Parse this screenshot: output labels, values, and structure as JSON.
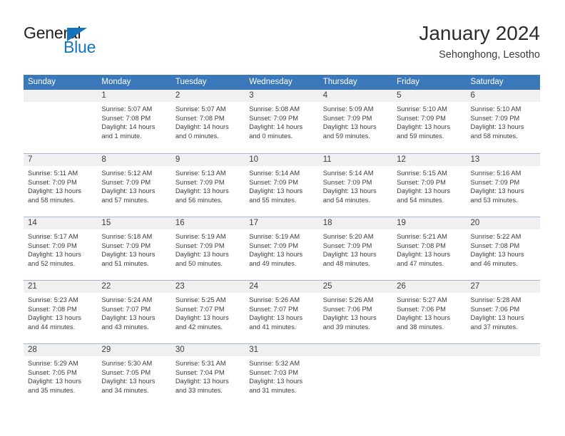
{
  "brand": {
    "name_part1": "General",
    "name_part2": "Blue",
    "accent_color": "#1474bb",
    "triangle_icon": "brand-triangle-icon"
  },
  "header": {
    "title": "January 2024",
    "subtitle": "Sehonghong, Lesotho"
  },
  "calendar": {
    "header_color": "#3a78ba",
    "daynum_band_color": "#f0f0f0",
    "weekdays": [
      "Sunday",
      "Monday",
      "Tuesday",
      "Wednesday",
      "Thursday",
      "Friday",
      "Saturday"
    ],
    "weeks": [
      [
        {
          "day": "",
          "blank": true,
          "sunrise": "",
          "sunset": "",
          "daylight1": "",
          "daylight2": ""
        },
        {
          "day": "1",
          "sunrise": "Sunrise: 5:07 AM",
          "sunset": "Sunset: 7:08 PM",
          "daylight1": "Daylight: 14 hours",
          "daylight2": "and 1 minute."
        },
        {
          "day": "2",
          "sunrise": "Sunrise: 5:07 AM",
          "sunset": "Sunset: 7:08 PM",
          "daylight1": "Daylight: 14 hours",
          "daylight2": "and 0 minutes."
        },
        {
          "day": "3",
          "sunrise": "Sunrise: 5:08 AM",
          "sunset": "Sunset: 7:09 PM",
          "daylight1": "Daylight: 14 hours",
          "daylight2": "and 0 minutes."
        },
        {
          "day": "4",
          "sunrise": "Sunrise: 5:09 AM",
          "sunset": "Sunset: 7:09 PM",
          "daylight1": "Daylight: 13 hours",
          "daylight2": "and 59 minutes."
        },
        {
          "day": "5",
          "sunrise": "Sunrise: 5:10 AM",
          "sunset": "Sunset: 7:09 PM",
          "daylight1": "Daylight: 13 hours",
          "daylight2": "and 59 minutes."
        },
        {
          "day": "6",
          "sunrise": "Sunrise: 5:10 AM",
          "sunset": "Sunset: 7:09 PM",
          "daylight1": "Daylight: 13 hours",
          "daylight2": "and 58 minutes."
        }
      ],
      [
        {
          "day": "7",
          "sunrise": "Sunrise: 5:11 AM",
          "sunset": "Sunset: 7:09 PM",
          "daylight1": "Daylight: 13 hours",
          "daylight2": "and 58 minutes."
        },
        {
          "day": "8",
          "sunrise": "Sunrise: 5:12 AM",
          "sunset": "Sunset: 7:09 PM",
          "daylight1": "Daylight: 13 hours",
          "daylight2": "and 57 minutes."
        },
        {
          "day": "9",
          "sunrise": "Sunrise: 5:13 AM",
          "sunset": "Sunset: 7:09 PM",
          "daylight1": "Daylight: 13 hours",
          "daylight2": "and 56 minutes."
        },
        {
          "day": "10",
          "sunrise": "Sunrise: 5:14 AM",
          "sunset": "Sunset: 7:09 PM",
          "daylight1": "Daylight: 13 hours",
          "daylight2": "and 55 minutes."
        },
        {
          "day": "11",
          "sunrise": "Sunrise: 5:14 AM",
          "sunset": "Sunset: 7:09 PM",
          "daylight1": "Daylight: 13 hours",
          "daylight2": "and 54 minutes."
        },
        {
          "day": "12",
          "sunrise": "Sunrise: 5:15 AM",
          "sunset": "Sunset: 7:09 PM",
          "daylight1": "Daylight: 13 hours",
          "daylight2": "and 54 minutes."
        },
        {
          "day": "13",
          "sunrise": "Sunrise: 5:16 AM",
          "sunset": "Sunset: 7:09 PM",
          "daylight1": "Daylight: 13 hours",
          "daylight2": "and 53 minutes."
        }
      ],
      [
        {
          "day": "14",
          "sunrise": "Sunrise: 5:17 AM",
          "sunset": "Sunset: 7:09 PM",
          "daylight1": "Daylight: 13 hours",
          "daylight2": "and 52 minutes."
        },
        {
          "day": "15",
          "sunrise": "Sunrise: 5:18 AM",
          "sunset": "Sunset: 7:09 PM",
          "daylight1": "Daylight: 13 hours",
          "daylight2": "and 51 minutes."
        },
        {
          "day": "16",
          "sunrise": "Sunrise: 5:19 AM",
          "sunset": "Sunset: 7:09 PM",
          "daylight1": "Daylight: 13 hours",
          "daylight2": "and 50 minutes."
        },
        {
          "day": "17",
          "sunrise": "Sunrise: 5:19 AM",
          "sunset": "Sunset: 7:09 PM",
          "daylight1": "Daylight: 13 hours",
          "daylight2": "and 49 minutes."
        },
        {
          "day": "18",
          "sunrise": "Sunrise: 5:20 AM",
          "sunset": "Sunset: 7:09 PM",
          "daylight1": "Daylight: 13 hours",
          "daylight2": "and 48 minutes."
        },
        {
          "day": "19",
          "sunrise": "Sunrise: 5:21 AM",
          "sunset": "Sunset: 7:08 PM",
          "daylight1": "Daylight: 13 hours",
          "daylight2": "and 47 minutes."
        },
        {
          "day": "20",
          "sunrise": "Sunrise: 5:22 AM",
          "sunset": "Sunset: 7:08 PM",
          "daylight1": "Daylight: 13 hours",
          "daylight2": "and 46 minutes."
        }
      ],
      [
        {
          "day": "21",
          "sunrise": "Sunrise: 5:23 AM",
          "sunset": "Sunset: 7:08 PM",
          "daylight1": "Daylight: 13 hours",
          "daylight2": "and 44 minutes."
        },
        {
          "day": "22",
          "sunrise": "Sunrise: 5:24 AM",
          "sunset": "Sunset: 7:07 PM",
          "daylight1": "Daylight: 13 hours",
          "daylight2": "and 43 minutes."
        },
        {
          "day": "23",
          "sunrise": "Sunrise: 5:25 AM",
          "sunset": "Sunset: 7:07 PM",
          "daylight1": "Daylight: 13 hours",
          "daylight2": "and 42 minutes."
        },
        {
          "day": "24",
          "sunrise": "Sunrise: 5:26 AM",
          "sunset": "Sunset: 7:07 PM",
          "daylight1": "Daylight: 13 hours",
          "daylight2": "and 41 minutes."
        },
        {
          "day": "25",
          "sunrise": "Sunrise: 5:26 AM",
          "sunset": "Sunset: 7:06 PM",
          "daylight1": "Daylight: 13 hours",
          "daylight2": "and 39 minutes."
        },
        {
          "day": "26",
          "sunrise": "Sunrise: 5:27 AM",
          "sunset": "Sunset: 7:06 PM",
          "daylight1": "Daylight: 13 hours",
          "daylight2": "and 38 minutes."
        },
        {
          "day": "27",
          "sunrise": "Sunrise: 5:28 AM",
          "sunset": "Sunset: 7:06 PM",
          "daylight1": "Daylight: 13 hours",
          "daylight2": "and 37 minutes."
        }
      ],
      [
        {
          "day": "28",
          "sunrise": "Sunrise: 5:29 AM",
          "sunset": "Sunset: 7:05 PM",
          "daylight1": "Daylight: 13 hours",
          "daylight2": "and 35 minutes."
        },
        {
          "day": "29",
          "sunrise": "Sunrise: 5:30 AM",
          "sunset": "Sunset: 7:05 PM",
          "daylight1": "Daylight: 13 hours",
          "daylight2": "and 34 minutes."
        },
        {
          "day": "30",
          "sunrise": "Sunrise: 5:31 AM",
          "sunset": "Sunset: 7:04 PM",
          "daylight1": "Daylight: 13 hours",
          "daylight2": "and 33 minutes."
        },
        {
          "day": "31",
          "sunrise": "Sunrise: 5:32 AM",
          "sunset": "Sunset: 7:03 PM",
          "daylight1": "Daylight: 13 hours",
          "daylight2": "and 31 minutes."
        },
        {
          "day": "",
          "blank": true,
          "sunrise": "",
          "sunset": "",
          "daylight1": "",
          "daylight2": ""
        },
        {
          "day": "",
          "blank": true,
          "sunrise": "",
          "sunset": "",
          "daylight1": "",
          "daylight2": ""
        },
        {
          "day": "",
          "blank": true,
          "sunrise": "",
          "sunset": "",
          "daylight1": "",
          "daylight2": ""
        }
      ]
    ]
  }
}
